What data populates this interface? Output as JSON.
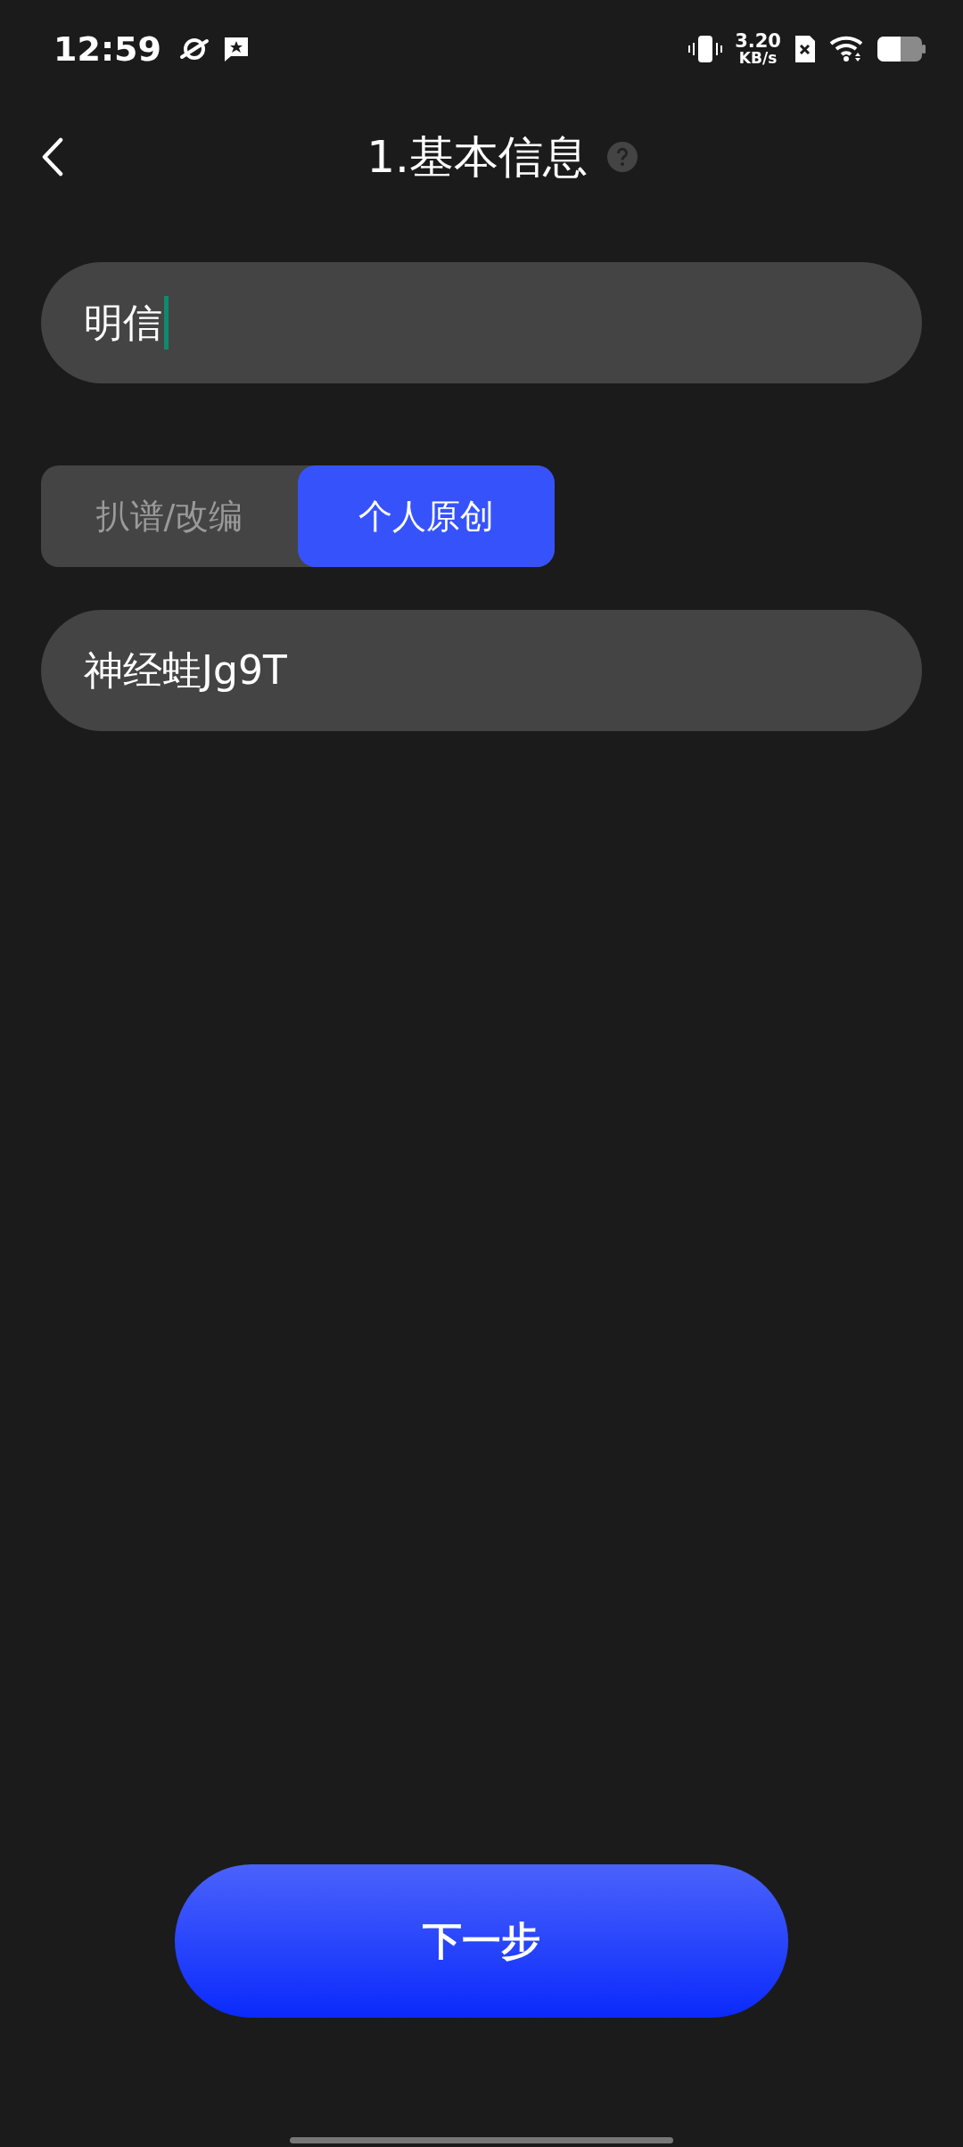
{
  "status_bar": {
    "time": "12:59",
    "speed_value": "3.20",
    "speed_unit": "KB/s"
  },
  "header": {
    "title": "1.基本信息"
  },
  "name_field": {
    "value": "明信",
    "focused": true
  },
  "segments": [
    {
      "label": "扒谱/改编",
      "selected": false
    },
    {
      "label": "个人原创",
      "selected": true
    }
  ],
  "author_field": {
    "value": "神经蛙Jg9T"
  },
  "next_button": {
    "label": "下一步"
  }
}
